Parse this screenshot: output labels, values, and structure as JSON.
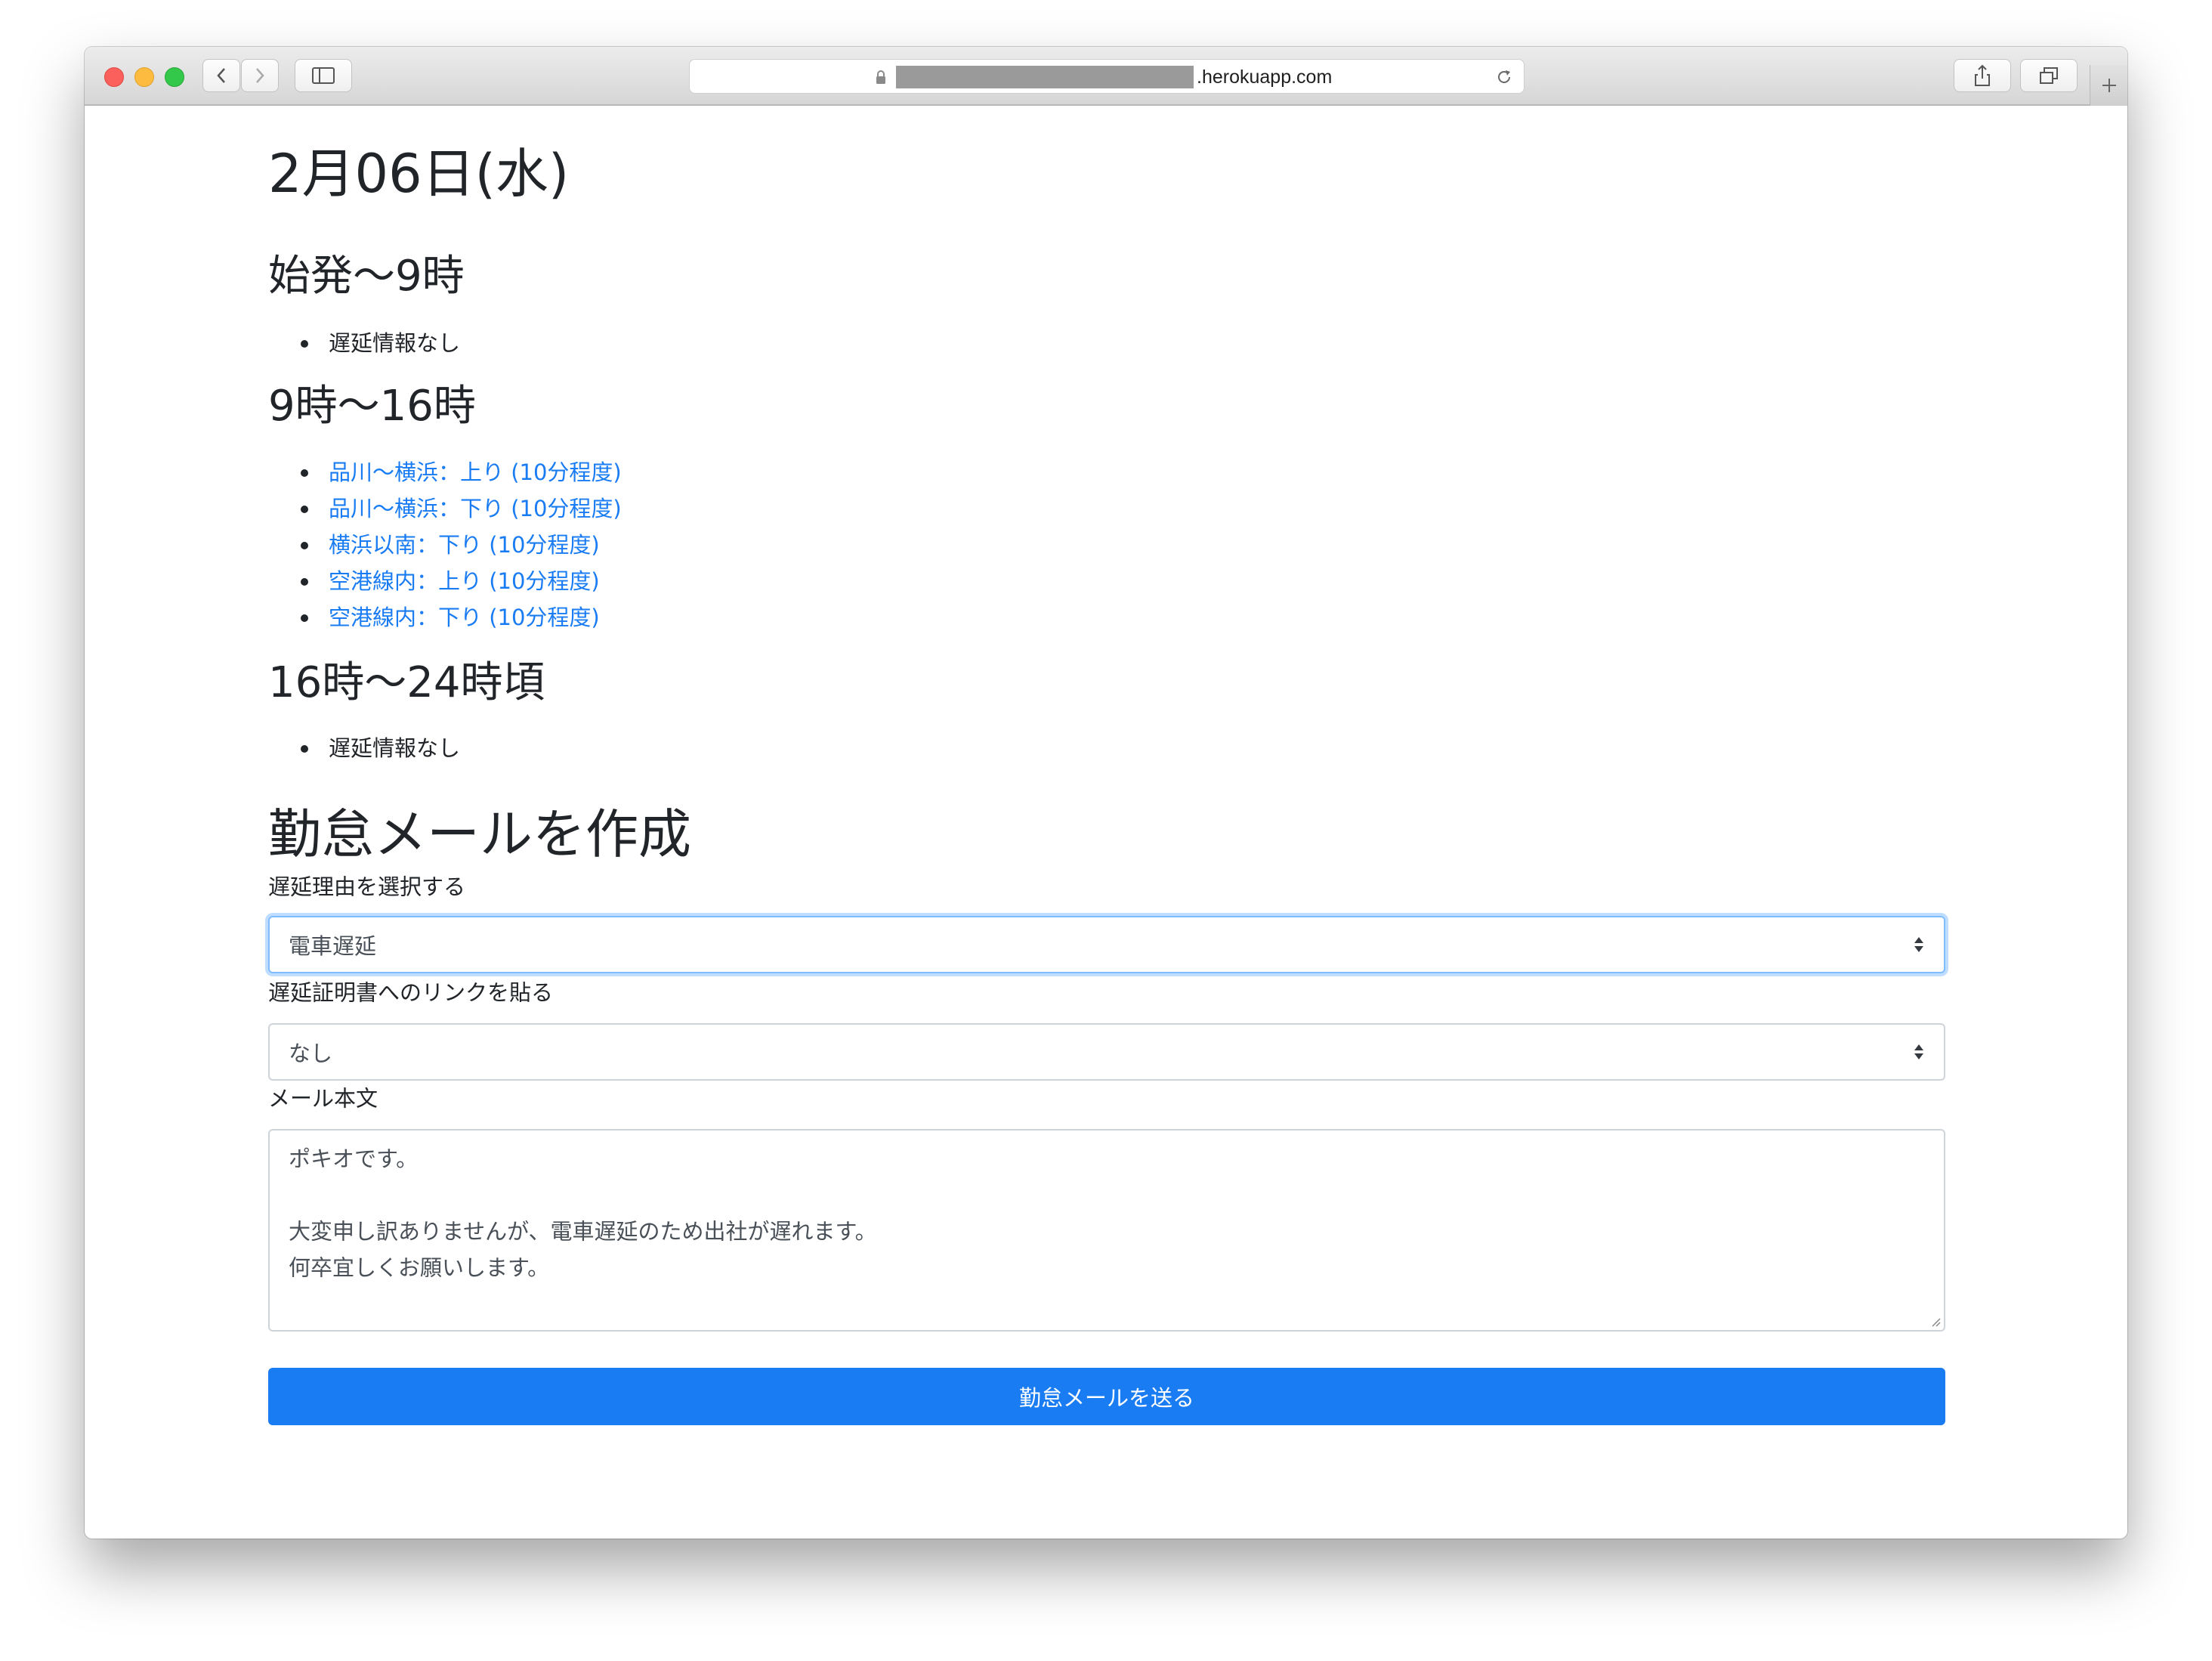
{
  "browser": {
    "url_domain": ".herokuapp.com"
  },
  "page": {
    "date_heading": "2月06日(水)",
    "sections": [
      {
        "title": "始発〜9時",
        "items": [
          {
            "text": "遅延情報なし",
            "is_link": false
          }
        ]
      },
      {
        "title": "9時〜16時",
        "items": [
          {
            "text": "品川〜横浜：上り (10分程度)",
            "is_link": true
          },
          {
            "text": "品川〜横浜：下り (10分程度)",
            "is_link": true
          },
          {
            "text": "横浜以南：下り (10分程度)",
            "is_link": true
          },
          {
            "text": "空港線内：上り (10分程度)",
            "is_link": true
          },
          {
            "text": "空港線内：下り (10分程度)",
            "is_link": true
          }
        ]
      },
      {
        "title": "16時〜24時頃",
        "items": [
          {
            "text": "遅延情報なし",
            "is_link": false
          }
        ]
      }
    ]
  },
  "form": {
    "heading": "勤怠メールを作成",
    "reason_label": "遅延理由を選択する",
    "reason_value": "電車遅延",
    "cert_label": "遅延証明書へのリンクを貼る",
    "cert_value": "なし",
    "body_label": "メール本文",
    "body_lines": [
      "ポキオです。",
      "",
      "大変申し訳ありませんが、電車遅延のため出社が遅れます。",
      "何卒宜しくお願いします。"
    ],
    "submit_label": "勤怠メールを送る"
  },
  "colors": {
    "link": "#1a7cf3",
    "primary_button": "#1a7cf3",
    "text": "#212529"
  }
}
